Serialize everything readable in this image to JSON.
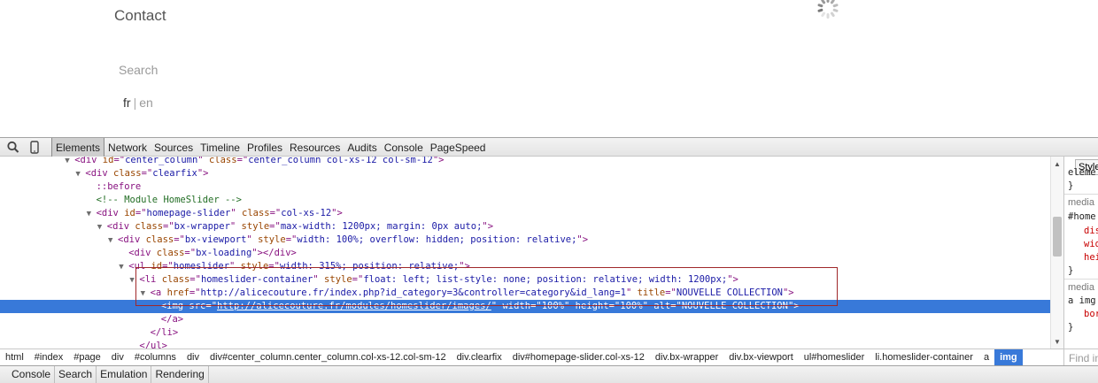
{
  "page": {
    "contact": "Contact",
    "search": "Search",
    "lang_fr": "fr",
    "lang_sep": "|",
    "lang_en": "en"
  },
  "devtools": {
    "tabs": [
      "Elements",
      "Network",
      "Sources",
      "Timeline",
      "Profiles",
      "Resources",
      "Audits",
      "Console",
      "PageSpeed"
    ],
    "active_tab": "Elements",
    "dom_lines": [
      {
        "indent": 6,
        "tri": "open",
        "parts": [
          [
            "tag",
            "<div "
          ],
          [
            "attr",
            "id"
          ],
          [
            "tag",
            "=\""
          ],
          [
            "val",
            "center_column"
          ],
          [
            "tag",
            "\" "
          ],
          [
            "attr",
            "class"
          ],
          [
            "tag",
            "=\""
          ],
          [
            "val",
            "center_column col-xs-12 col-sm-12"
          ],
          [
            "tag",
            "\">"
          ]
        ]
      },
      {
        "indent": 7,
        "tri": "open",
        "parts": [
          [
            "tag",
            "<div "
          ],
          [
            "attr",
            "class"
          ],
          [
            "tag",
            "=\""
          ],
          [
            "val",
            "clearfix"
          ],
          [
            "tag",
            "\">"
          ]
        ]
      },
      {
        "indent": 8,
        "tri": "none",
        "parts": [
          [
            "pseudo",
            "::before"
          ]
        ]
      },
      {
        "indent": 8,
        "tri": "none",
        "parts": [
          [
            "comment",
            "<!-- Module HomeSlider -->"
          ]
        ]
      },
      {
        "indent": 8,
        "tri": "open",
        "parts": [
          [
            "tag",
            "<div "
          ],
          [
            "attr",
            "id"
          ],
          [
            "tag",
            "=\""
          ],
          [
            "val",
            "homepage-slider"
          ],
          [
            "tag",
            "\" "
          ],
          [
            "attr",
            "class"
          ],
          [
            "tag",
            "=\""
          ],
          [
            "val",
            "col-xs-12"
          ],
          [
            "tag",
            "\">"
          ]
        ]
      },
      {
        "indent": 9,
        "tri": "open",
        "parts": [
          [
            "tag",
            "<div "
          ],
          [
            "attr",
            "class"
          ],
          [
            "tag",
            "=\""
          ],
          [
            "val",
            "bx-wrapper"
          ],
          [
            "tag",
            "\" "
          ],
          [
            "attr",
            "style"
          ],
          [
            "tag",
            "=\""
          ],
          [
            "val",
            "max-width: 1200px; margin: 0px auto;"
          ],
          [
            "tag",
            "\">"
          ]
        ]
      },
      {
        "indent": 10,
        "tri": "open",
        "parts": [
          [
            "tag",
            "<div "
          ],
          [
            "attr",
            "class"
          ],
          [
            "tag",
            "=\""
          ],
          [
            "val",
            "bx-viewport"
          ],
          [
            "tag",
            "\" "
          ],
          [
            "attr",
            "style"
          ],
          [
            "tag",
            "=\""
          ],
          [
            "val",
            "width: 100%; overflow: hidden; position: relative;"
          ],
          [
            "tag",
            "\">"
          ]
        ]
      },
      {
        "indent": 11,
        "tri": "none",
        "parts": [
          [
            "tag",
            "<div "
          ],
          [
            "attr",
            "class"
          ],
          [
            "tag",
            "=\""
          ],
          [
            "val",
            "bx-loading"
          ],
          [
            "tag",
            "\"></div>"
          ]
        ]
      },
      {
        "indent": 11,
        "tri": "open",
        "parts": [
          [
            "tag",
            "<ul "
          ],
          [
            "attr",
            "id"
          ],
          [
            "tag",
            "=\""
          ],
          [
            "val",
            "homeslider"
          ],
          [
            "tag",
            "\" "
          ],
          [
            "attr",
            "style"
          ],
          [
            "tag",
            "=\""
          ],
          [
            "val",
            "width: 315%; position: relative;"
          ],
          [
            "tag",
            "\">"
          ]
        ]
      },
      {
        "indent": 12,
        "tri": "open",
        "parts": [
          [
            "tag",
            "<li "
          ],
          [
            "attr",
            "class"
          ],
          [
            "tag",
            "=\""
          ],
          [
            "val",
            "homeslider-container"
          ],
          [
            "tag",
            "\" "
          ],
          [
            "attr",
            "style"
          ],
          [
            "tag",
            "=\""
          ],
          [
            "val",
            "float: left; list-style: none; position: relative; width: 1200px;"
          ],
          [
            "tag",
            "\">"
          ]
        ]
      },
      {
        "indent": 13,
        "tri": "open",
        "parts": [
          [
            "tag",
            "<a "
          ],
          [
            "attr",
            "href"
          ],
          [
            "tag",
            "=\""
          ],
          [
            "val",
            "http://alicecouture.fr/index.php?id_category=3&controller=category&id_lang=1"
          ],
          [
            "tag",
            "\" "
          ],
          [
            "attr",
            "title"
          ],
          [
            "tag",
            "=\""
          ],
          [
            "val",
            "NOUVELLE COLLECTION"
          ],
          [
            "tag",
            "\">"
          ]
        ]
      },
      {
        "indent": 14,
        "tri": "none",
        "selected": true,
        "parts": [
          [
            "tag",
            "<img "
          ],
          [
            "attr",
            "src"
          ],
          [
            "tag",
            "=\""
          ],
          [
            "link",
            "http://alicecouture.fr/modules/homeslider/images/"
          ],
          [
            "tag",
            "\" "
          ],
          [
            "attr",
            "width"
          ],
          [
            "tag",
            "=\""
          ],
          [
            "val",
            "100%"
          ],
          [
            "tag",
            "\" "
          ],
          [
            "attr",
            "height"
          ],
          [
            "tag",
            "=\""
          ],
          [
            "val",
            "100%"
          ],
          [
            "tag",
            "\" "
          ],
          [
            "attr",
            "alt"
          ],
          [
            "tag",
            "=\""
          ],
          [
            "val",
            "NOUVELLE COLLECTION"
          ],
          [
            "tag",
            "\">"
          ]
        ]
      },
      {
        "indent": 14,
        "tri": "none",
        "parts": [
          [
            "tag",
            "</a>"
          ]
        ]
      },
      {
        "indent": 13,
        "tri": "none",
        "parts": [
          [
            "tag",
            "</li>"
          ]
        ]
      },
      {
        "indent": 12,
        "tri": "none",
        "parts": [
          [
            "tag",
            "</ul>"
          ]
        ]
      }
    ],
    "styles_tab": "Styles",
    "styles_lines": [
      "eleme",
      "}",
      "media",
      "#home",
      "dis",
      "wid",
      "hei",
      "}",
      "media",
      "a img",
      "bor",
      "}"
    ],
    "find_placeholder": "Find in",
    "breadcrumbs": [
      "html",
      "#index",
      "#page",
      "div",
      "#columns",
      "div",
      "div#center_column.center_column.col-xs-12.col-sm-12",
      "div.clearfix",
      "div#homepage-slider.col-xs-12",
      "div.bx-wrapper",
      "div.bx-viewport",
      "ul#homeslider",
      "li.homeslider-container",
      "a",
      "img"
    ],
    "active_breadcrumb": "img",
    "drawer_tabs": [
      "Console",
      "Search",
      "Emulation",
      "Rendering"
    ]
  },
  "colors": {
    "selection": "#3879d9",
    "tag": "#881280",
    "attr": "#994500",
    "value": "#1a1aa6",
    "comment": "#236e25",
    "highlight_border": "#a0282a"
  },
  "icons": {
    "inspect": "search-icon",
    "device": "mobile-device-icon",
    "loading": "spinner-icon"
  }
}
